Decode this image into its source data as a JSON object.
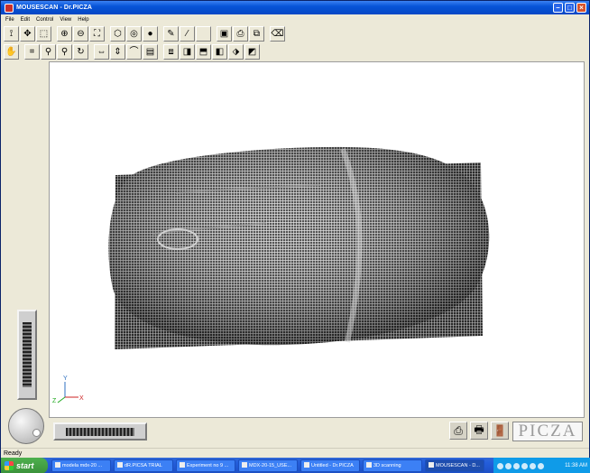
{
  "window": {
    "title": "MOUSESCAN - Dr.PICZA"
  },
  "menu": [
    "File",
    "Edit",
    "Control",
    "View",
    "Help"
  ],
  "toolbar1": [
    {
      "icon": "pointer-icon",
      "glyph": "⟟"
    },
    {
      "icon": "pan-icon",
      "glyph": "✥"
    },
    {
      "icon": "select-icon",
      "glyph": "⬚"
    },
    {
      "icon": "zoom-in-icon",
      "glyph": "⊕"
    },
    {
      "icon": "zoom-out-icon",
      "glyph": "⊖"
    },
    {
      "icon": "zoom-fit-icon",
      "glyph": "⛶"
    },
    {
      "icon": "wireframe-icon",
      "glyph": "⬡"
    },
    {
      "icon": "shade-icon",
      "glyph": "◎"
    },
    {
      "icon": "sphere-icon",
      "glyph": "●"
    },
    {
      "icon": "pen-icon",
      "glyph": "✎"
    },
    {
      "icon": "brush-icon",
      "glyph": "⁄"
    },
    {
      "icon": "blank-icon",
      "glyph": ""
    },
    {
      "icon": "cube-icon",
      "glyph": "▣"
    },
    {
      "icon": "print-preview-icon",
      "glyph": "⎙"
    },
    {
      "icon": "scan-icon",
      "glyph": "⧉"
    },
    {
      "icon": "eraser-icon",
      "glyph": "⌫"
    }
  ],
  "toolbar2": [
    {
      "icon": "hand-icon",
      "glyph": "✋"
    },
    {
      "icon": "crop-icon",
      "glyph": "⌗"
    },
    {
      "icon": "magnify-icon",
      "glyph": "⚲"
    },
    {
      "icon": "zoom-region-icon",
      "glyph": "⚲"
    },
    {
      "icon": "rotate-icon",
      "glyph": "↻"
    },
    {
      "icon": "mirror-x-icon",
      "glyph": "⇔"
    },
    {
      "icon": "mirror-y-icon",
      "glyph": "⇕"
    },
    {
      "icon": "warp-icon",
      "glyph": "⌒"
    },
    {
      "icon": "section-icon",
      "glyph": "▤"
    },
    {
      "icon": "layer-icon",
      "glyph": "⧈"
    },
    {
      "icon": "view-front-icon",
      "glyph": "◨"
    },
    {
      "icon": "view-top-icon",
      "glyph": "⬒"
    },
    {
      "icon": "view-side-icon",
      "glyph": "◧"
    },
    {
      "icon": "view-iso-icon",
      "glyph": "⬗"
    },
    {
      "icon": "view-back-icon",
      "glyph": "◩"
    }
  ],
  "axes": {
    "x": "X",
    "y": "Y",
    "z": "Z"
  },
  "brand": "PICZA",
  "status": "Ready",
  "taskbar": {
    "start": "start",
    "tasks": [
      {
        "label": "modela mdx-20 ...",
        "active": false
      },
      {
        "label": "dR.PICSA TRIAL",
        "active": false
      },
      {
        "label": "Experiment no 9 ...",
        "active": false
      },
      {
        "label": "MDX-20-15_USE...",
        "active": false
      },
      {
        "label": "Untitled - Dr.PICZA",
        "active": false
      },
      {
        "label": "3D scanning",
        "active": false
      },
      {
        "label": "MOUSESCAN - D...",
        "active": true
      }
    ],
    "clock": "11:38 AM"
  }
}
